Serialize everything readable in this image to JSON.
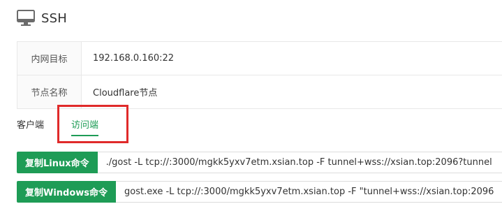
{
  "header": {
    "title": "SSH",
    "icon": "monitor-icon"
  },
  "info": {
    "rows": [
      {
        "label": "内网目标",
        "value": "192.168.0.160:22"
      },
      {
        "label": "节点名称",
        "value": "Cloudflare节点"
      }
    ]
  },
  "tabs": {
    "client": "客户端",
    "visitor": "访问端",
    "active": "访问端"
  },
  "commands": {
    "linux": {
      "button": "复制Linux命令",
      "text": "./gost -L tcp://:3000/mgkk5yxv7etm.xsian.top -F tunnel+wss://xsian.top:2096?tunnel"
    },
    "windows": {
      "button": "复制Windows命令",
      "text": "gost.exe -L tcp://:3000/mgkk5yxv7etm.xsian.top -F \"tunnel+wss://xsian.top:2096"
    }
  },
  "colors": {
    "accent": "#1e9c56",
    "highlight": "#e02a2a"
  }
}
